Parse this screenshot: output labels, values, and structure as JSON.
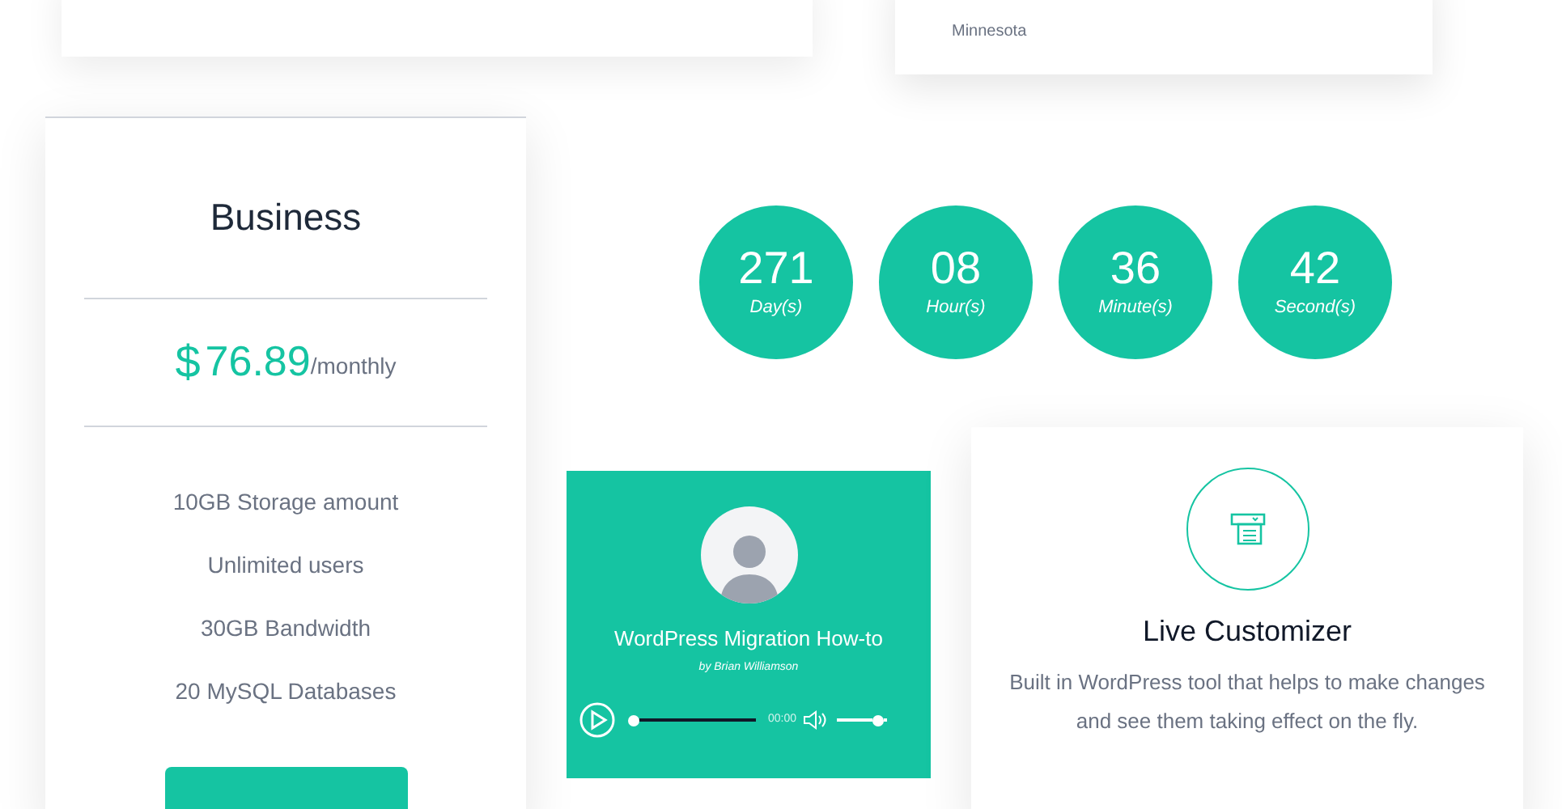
{
  "location_card": {
    "text": "Minnesota"
  },
  "pricing": {
    "plan": "Business",
    "currency": "$",
    "price": "76.89",
    "period": "/monthly",
    "features": [
      "10GB Storage amount",
      "Unlimited users",
      "30GB Bandwidth",
      "20 MySQL Databases"
    ]
  },
  "countdown": [
    {
      "value": "271",
      "unit": "Day(s)"
    },
    {
      "value": "08",
      "unit": "Hour(s)"
    },
    {
      "value": "36",
      "unit": "Minute(s)"
    },
    {
      "value": "42",
      "unit": "Second(s)"
    }
  ],
  "audio_player": {
    "title": "WordPress Migration How-to",
    "author": "by Brian Williamson",
    "time": "00:00",
    "progress": {
      "level": 0
    },
    "volume": {
      "level": 0.9
    }
  },
  "feature": {
    "title": "Live Customizer",
    "description": "Built in WordPress tool that helps to make changes and see them taking effect on the fly."
  }
}
